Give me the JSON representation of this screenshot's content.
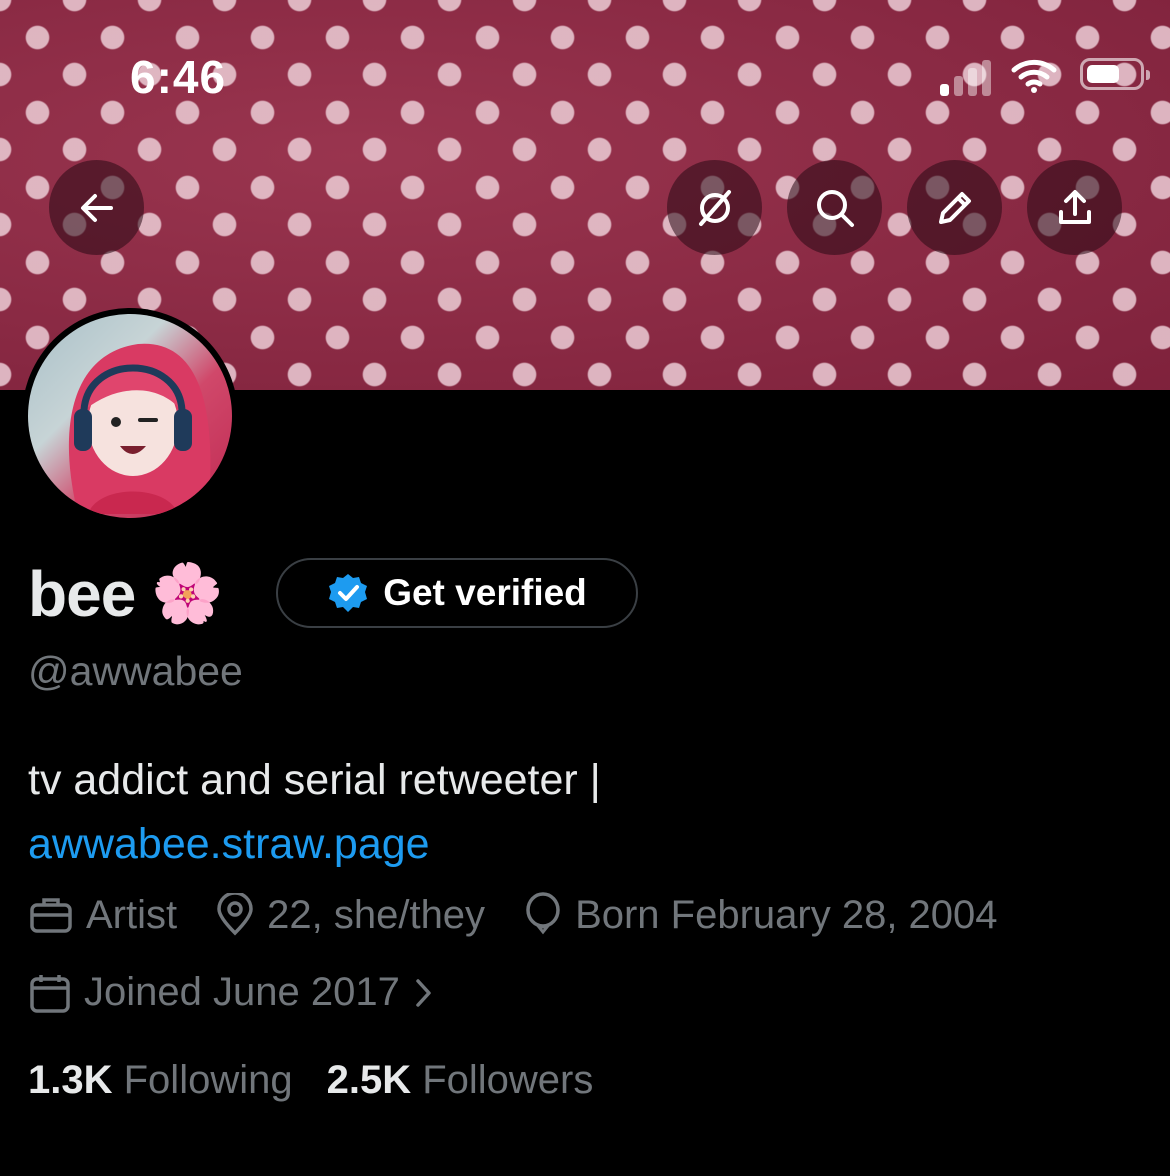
{
  "status_bar": {
    "time": "6:46"
  },
  "header": {
    "back_icon": "arrow-left-icon",
    "actions": [
      "grok-icon",
      "search-icon",
      "pencil-icon",
      "share-icon"
    ]
  },
  "profile": {
    "name": "bee",
    "emoji": "🌸",
    "verify_button": "Get verified",
    "handle": "@awwabee",
    "bio_text": "tv addict and serial retweeter |",
    "bio_link": "awwabee.straw.page",
    "profession": "Artist",
    "location": "22, she/they",
    "birthday": "Born February 28, 2004",
    "joined": "Joined June 2017",
    "following_count": "1.3K",
    "following_label": "Following",
    "followers_count": "2.5K",
    "followers_label": "Followers"
  },
  "colors": {
    "accent": "#1d9bf0",
    "muted": "#71767b",
    "banner": "#8f2a45"
  }
}
